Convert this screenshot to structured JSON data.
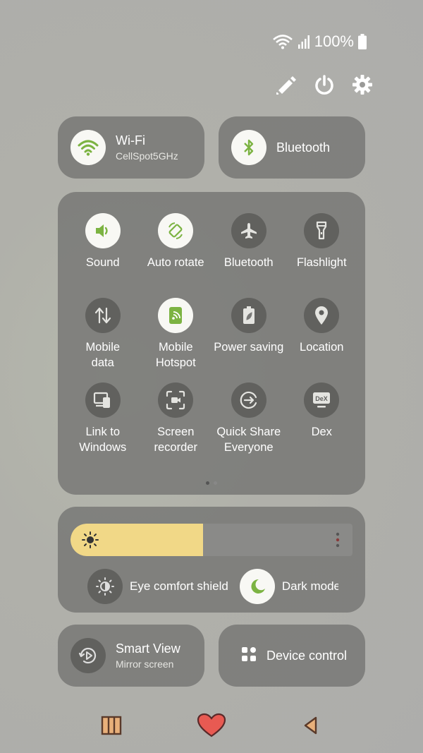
{
  "status": {
    "battery": "100%"
  },
  "top_actions": [
    "edit-icon",
    "power-icon",
    "settings-icon"
  ],
  "wifi_tile": {
    "title": "Wi-Fi",
    "subtitle": "CellSpot5GHz"
  },
  "bluetooth_tile": {
    "title": "Bluetooth"
  },
  "quick_settings": [
    {
      "label": "Sound",
      "on": true,
      "icon": "sound-icon"
    },
    {
      "label": "Auto rotate",
      "on": true,
      "icon": "auto-rotate-icon"
    },
    {
      "label": "Bluetooth",
      "on": false,
      "icon": "airplane-icon"
    },
    {
      "label": "Flashlight",
      "on": false,
      "icon": "flashlight-icon"
    },
    {
      "label": "Mobile\ndata",
      "on": false,
      "icon": "mobile-data-icon"
    },
    {
      "label": "Mobile\nHotspot",
      "on": true,
      "icon": "hotspot-icon"
    },
    {
      "label": "Power saving",
      "on": false,
      "icon": "power-saving-icon"
    },
    {
      "label": "Location",
      "on": false,
      "icon": "location-icon"
    },
    {
      "label": "Link to\nWindows",
      "on": false,
      "icon": "link-to-windows-icon"
    },
    {
      "label": "Screen\nrecorder",
      "on": false,
      "icon": "screen-recorder-icon"
    },
    {
      "label": "Quick Share\nEveryone",
      "on": false,
      "icon": "quick-share-icon"
    },
    {
      "label": "Dex",
      "on": false,
      "icon": "dex-icon"
    }
  ],
  "page_indicator": {
    "current": 1,
    "total": 2
  },
  "brightness": {
    "level": 0.47
  },
  "eye_comfort": {
    "label": "Eye comfort shield",
    "on": false
  },
  "dark_mode": {
    "label": "Dark mode",
    "on": true
  },
  "smart_view": {
    "title": "Smart View",
    "subtitle": "Mirror screen"
  },
  "device_control": {
    "title": "Device control"
  },
  "colors": {
    "accent": "#7cb342",
    "tile_bg": "#787876",
    "brightness_fill": "#f1d887"
  },
  "nav": [
    "recents-icon",
    "home-heart-icon",
    "back-icon"
  ]
}
